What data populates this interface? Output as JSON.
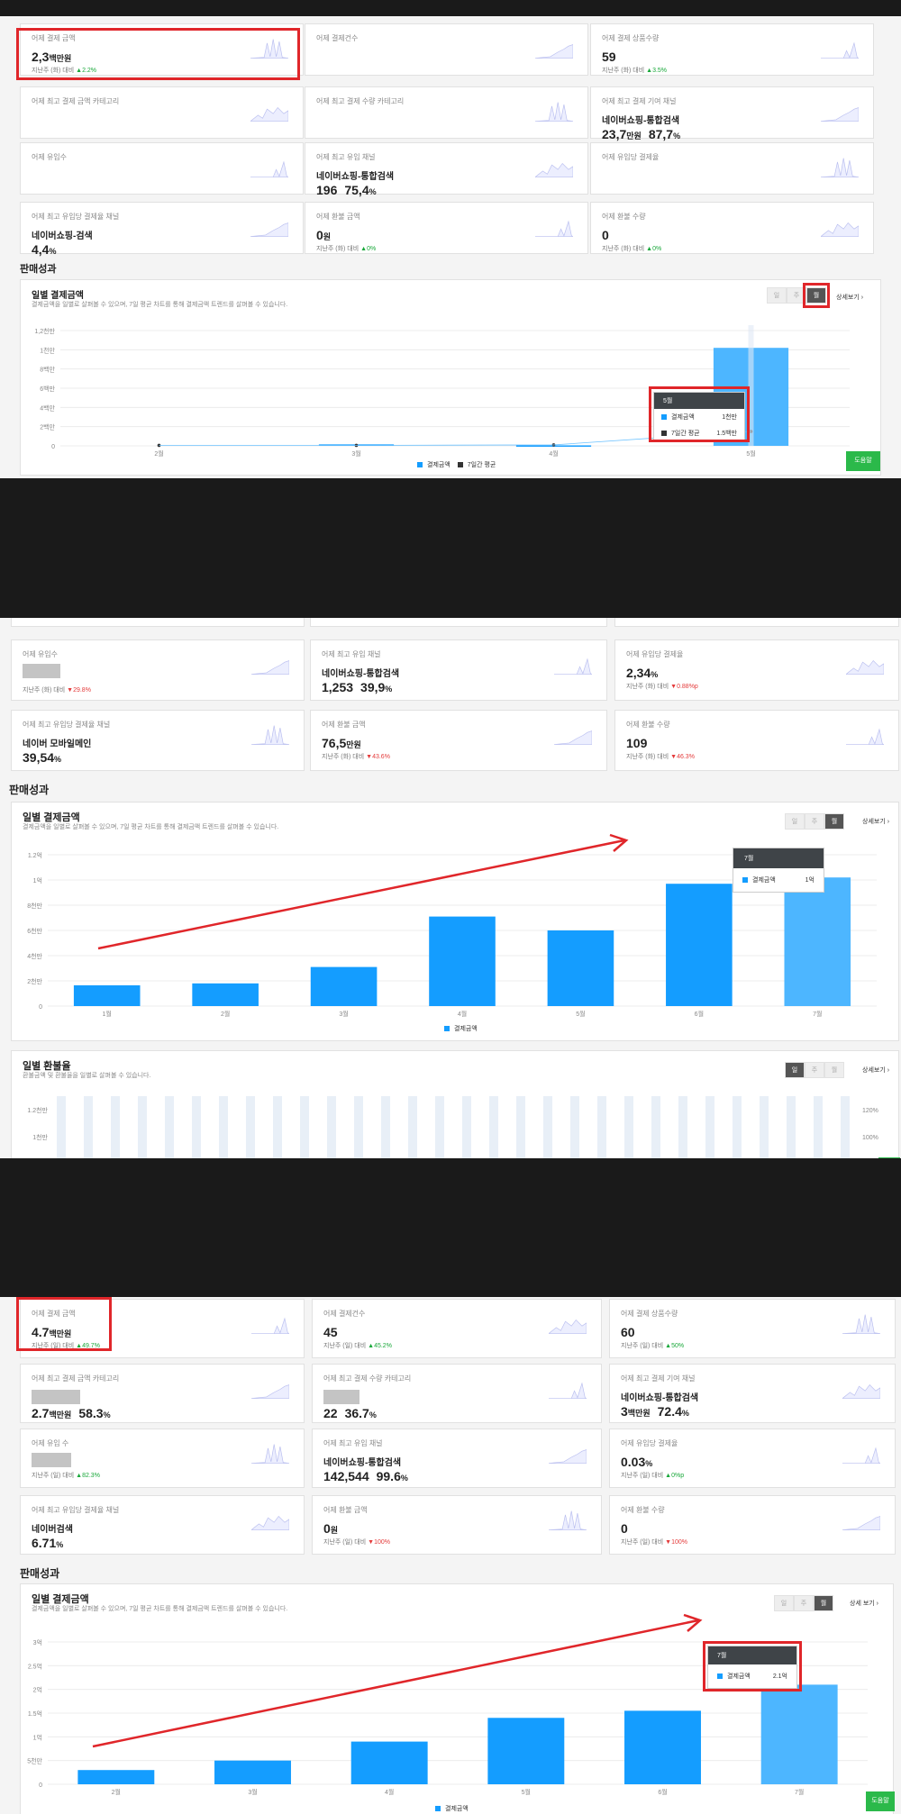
{
  "panel1": {
    "cards": [
      {
        "label": "어제 결제 금액",
        "value": "2,3",
        "unit": "백만원",
        "sub": "지난주 (화) 대비",
        "change": "2.2%",
        "dir": "up"
      },
      {
        "label": "어제 결제건수",
        "value": "",
        "unit": "",
        "sub": "",
        "change": "",
        "dir": ""
      },
      {
        "label": "어제 결제 상품수량",
        "value": "59",
        "unit": "",
        "sub": "지난주 (화) 대비",
        "change": "3.5%",
        "dir": "up"
      },
      {
        "label": "어제 최고 결제 금액 카테고리",
        "value": "",
        "unit": "",
        "sub": "",
        "change": "",
        "dir": ""
      },
      {
        "label": "어제 최고 결제 수량 카테고리",
        "value": "",
        "unit": "",
        "sub": "",
        "change": "",
        "dir": ""
      },
      {
        "label": "어제 최고 결제 기여 채널",
        "name": "네이버쇼핑-통합검색",
        "value": "23,7",
        "unit": "만원",
        "value2": "87,7",
        "unit2": "%"
      },
      {
        "label": "어제 유입수",
        "value": "",
        "unit": "",
        "sub": "",
        "change": "",
        "dir": ""
      },
      {
        "label": "어제 최고 유입 채널",
        "name": "네이버쇼핑-통합검색",
        "value": "196",
        "unit": "",
        "value2": "75,4",
        "unit2": "%"
      },
      {
        "label": "어제 유입당 결제율",
        "value": "",
        "unit": "",
        "sub": "",
        "change": "",
        "dir": ""
      },
      {
        "label": "어제 최고 유입당 결제율 채널",
        "name": "네이버쇼핑-검색",
        "value": "4,4",
        "unit": "%"
      },
      {
        "label": "어제 환불 금액",
        "value": "0",
        "unit": "원",
        "sub": "지난주 (화) 대비",
        "change": "0%",
        "dir": "up"
      },
      {
        "label": "어제 환불 수량",
        "value": "0",
        "unit": "",
        "sub": "지난주 (화) 대비",
        "change": "0%",
        "dir": "up"
      }
    ],
    "section": "판매성과",
    "chart": {
      "title": "일별 결제금액",
      "desc": "결제금액을 일별로 살펴볼 수 있으며, 7일 평균 차트를 통해 결제금액 트렌드를 살펴볼 수 있습니다.",
      "seg": [
        "일",
        "주",
        "월"
      ],
      "detail": "상세보기 ›",
      "yticks": [
        "1,2천만",
        "1천만",
        "8백만",
        "6백만",
        "4백만",
        "2백만",
        "0"
      ],
      "legend": [
        "결제금액",
        "7일간 평균"
      ],
      "tooltip": {
        "title": "5월",
        "row1_label": "결제금액",
        "row1_value": "1천만",
        "row2_label": "7일간 평균",
        "row2_value": "1.5백만"
      },
      "help": "도움말"
    },
    "chart_data": {
      "type": "bar",
      "categories": [
        "2월",
        "3월",
        "4월",
        "5월"
      ],
      "series": [
        {
          "name": "결제금액",
          "values": [
            0,
            0.15,
            0.05,
            10.2
          ]
        },
        {
          "name": "7일간 평균",
          "values": [
            0.05,
            0.05,
            0.1,
            1.5
          ]
        }
      ],
      "ylim": [
        0,
        12
      ]
    }
  },
  "panel2": {
    "cards": [
      {
        "label": "어제 유입수",
        "value": "",
        "unit": "",
        "sub": "지난주 (화) 대비",
        "change": "29.8%",
        "dir": "down"
      },
      {
        "label": "어제 최고 유입 채널",
        "name": "네이버쇼핑-통합검색",
        "value": "1,253",
        "unit": "",
        "value2": "39,9",
        "unit2": "%"
      },
      {
        "label": "어제 유입당 결제율",
        "value": "2,34",
        "unit": "%",
        "sub": "지난주 (화) 대비",
        "change": "0.88%p",
        "dir": "down"
      },
      {
        "label": "어제 최고 유입당 결제율 채널",
        "name": "네이버 모바일메인",
        "value": "39,54",
        "unit": "%"
      },
      {
        "label": "어제 환불 금액",
        "value": "76,5",
        "unit": "만원",
        "sub": "지난주 (화) 대비",
        "change": "43.6%",
        "dir": "down"
      },
      {
        "label": "어제 환불 수량",
        "value": "109",
        "unit": "",
        "sub": "지난주 (화) 대비",
        "change": "46.3%",
        "dir": "down"
      }
    ],
    "section": "판매성과",
    "chart": {
      "title": "일별 결제금액",
      "desc": "결제금액을 일별로 살펴볼 수 있으며, 7일 평균 차트를 통해 결제금액 트렌드를 살펴볼 수 있습니다.",
      "seg": [
        "일",
        "주",
        "월"
      ],
      "detail": "상세보기 ›",
      "yticks": [
        "1.2억",
        "1억",
        "8천만",
        "6천만",
        "4천만",
        "2천만",
        "0"
      ],
      "legend": [
        "결제금액"
      ],
      "tooltip": {
        "title": "7월",
        "row1_label": "결제금액",
        "row1_value": "1억"
      }
    },
    "chart_data": {
      "type": "bar",
      "categories": [
        "1월",
        "2월",
        "3월",
        "4월",
        "5월",
        "6월",
        "7월"
      ],
      "series": [
        {
          "name": "결제금액",
          "values": [
            1.65,
            1.8,
            3.1,
            7.1,
            6.0,
            9.7,
            10.2
          ]
        }
      ],
      "ylim": [
        0,
        12
      ]
    },
    "refund": {
      "title": "일별 환불율",
      "desc": "환불금액 및 환불율을 일별로 살펴볼 수 있습니다.",
      "seg": [
        "일",
        "주",
        "월"
      ],
      "detail": "상세보기 ›",
      "yticks": [
        "1.2천만",
        "1천만"
      ],
      "ryticks": [
        "120%",
        "100%"
      ]
    }
  },
  "panel3": {
    "cards": [
      {
        "label": "어제 결제 금액",
        "value": "4.7",
        "unit": "백만원",
        "sub": "지난주 (일) 대비",
        "change": "49.7%",
        "dir": "up"
      },
      {
        "label": "어제 결제건수",
        "value": "45",
        "unit": "",
        "sub": "지난주 (일) 대비",
        "change": "45.2%",
        "dir": "up"
      },
      {
        "label": "어제 결제 상품수량",
        "value": "60",
        "unit": "",
        "sub": "지난주 (일) 대비",
        "change": "50%",
        "dir": "up"
      },
      {
        "label": "어제 최고 결제 금액 카테고리",
        "value": "2.7",
        "unit": "백만원",
        "value2": "58.3",
        "unit2": "%"
      },
      {
        "label": "어제 최고 결제 수량 카테고리",
        "value": "22",
        "unit": "",
        "value2": "36.7",
        "unit2": "%"
      },
      {
        "label": "어제 최고 결제 기여 채널",
        "name": "네이버쇼핑-통합검색",
        "value": "3",
        "unit": "백만원",
        "value2": "72.4",
        "unit2": "%"
      },
      {
        "label": "어제 유입 수",
        "value": "",
        "unit": "",
        "sub": "지난주 (일) 대비",
        "change": "82.3%",
        "dir": "up"
      },
      {
        "label": "어제 최고 유입 채널",
        "name": "네이버쇼핑-통합검색",
        "value": "142,544",
        "unit": "",
        "value2": "99.6",
        "unit2": "%"
      },
      {
        "label": "어제 유입당 결제율",
        "value": "0.03",
        "unit": "%",
        "sub": "지난주 (일) 대비",
        "change": "0%p",
        "dir": "up"
      },
      {
        "label": "어제 최고 유입당 결제율 채널",
        "name": "네이버검색",
        "value": "6.71",
        "unit": "%"
      },
      {
        "label": "어제 환불 금액",
        "value": "0",
        "unit": "원",
        "sub": "지난주 (일) 대비",
        "change": "100%",
        "dir": "down"
      },
      {
        "label": "어제 환불 수량",
        "value": "0",
        "unit": "",
        "sub": "지난주 (일) 대비",
        "change": "100%",
        "dir": "down"
      }
    ],
    "section": "판매성과",
    "chart": {
      "title": "일별 결제금액",
      "desc": "결제금액을 일별로 살펴볼 수 있으며, 7일 평균 차트를 통해 결제금액 트렌드를 살펴볼 수 있습니다.",
      "seg": [
        "일",
        "주",
        "월"
      ],
      "detail": "상세 보기 ›",
      "yticks": [
        "3억",
        "2.5억",
        "2억",
        "1.5억",
        "1억",
        "5천만",
        "0"
      ],
      "legend": [
        "결제금액"
      ],
      "tooltip": {
        "title": "7월",
        "row1_label": "결제금액",
        "row1_value": "2.1억"
      },
      "help": "도움말"
    },
    "chart_data": {
      "type": "bar",
      "categories": [
        "2월",
        "3월",
        "4월",
        "5월",
        "6월",
        "7월"
      ],
      "series": [
        {
          "name": "결제금액",
          "values": [
            0.3,
            0.5,
            0.9,
            1.4,
            1.55,
            2.1
          ]
        }
      ],
      "ylim": [
        0,
        3
      ]
    }
  },
  "colors": {
    "bar": "#149dff",
    "bar_last": "#4db6ff",
    "accent_red": "#e0262a",
    "help": "#2bb94a"
  }
}
